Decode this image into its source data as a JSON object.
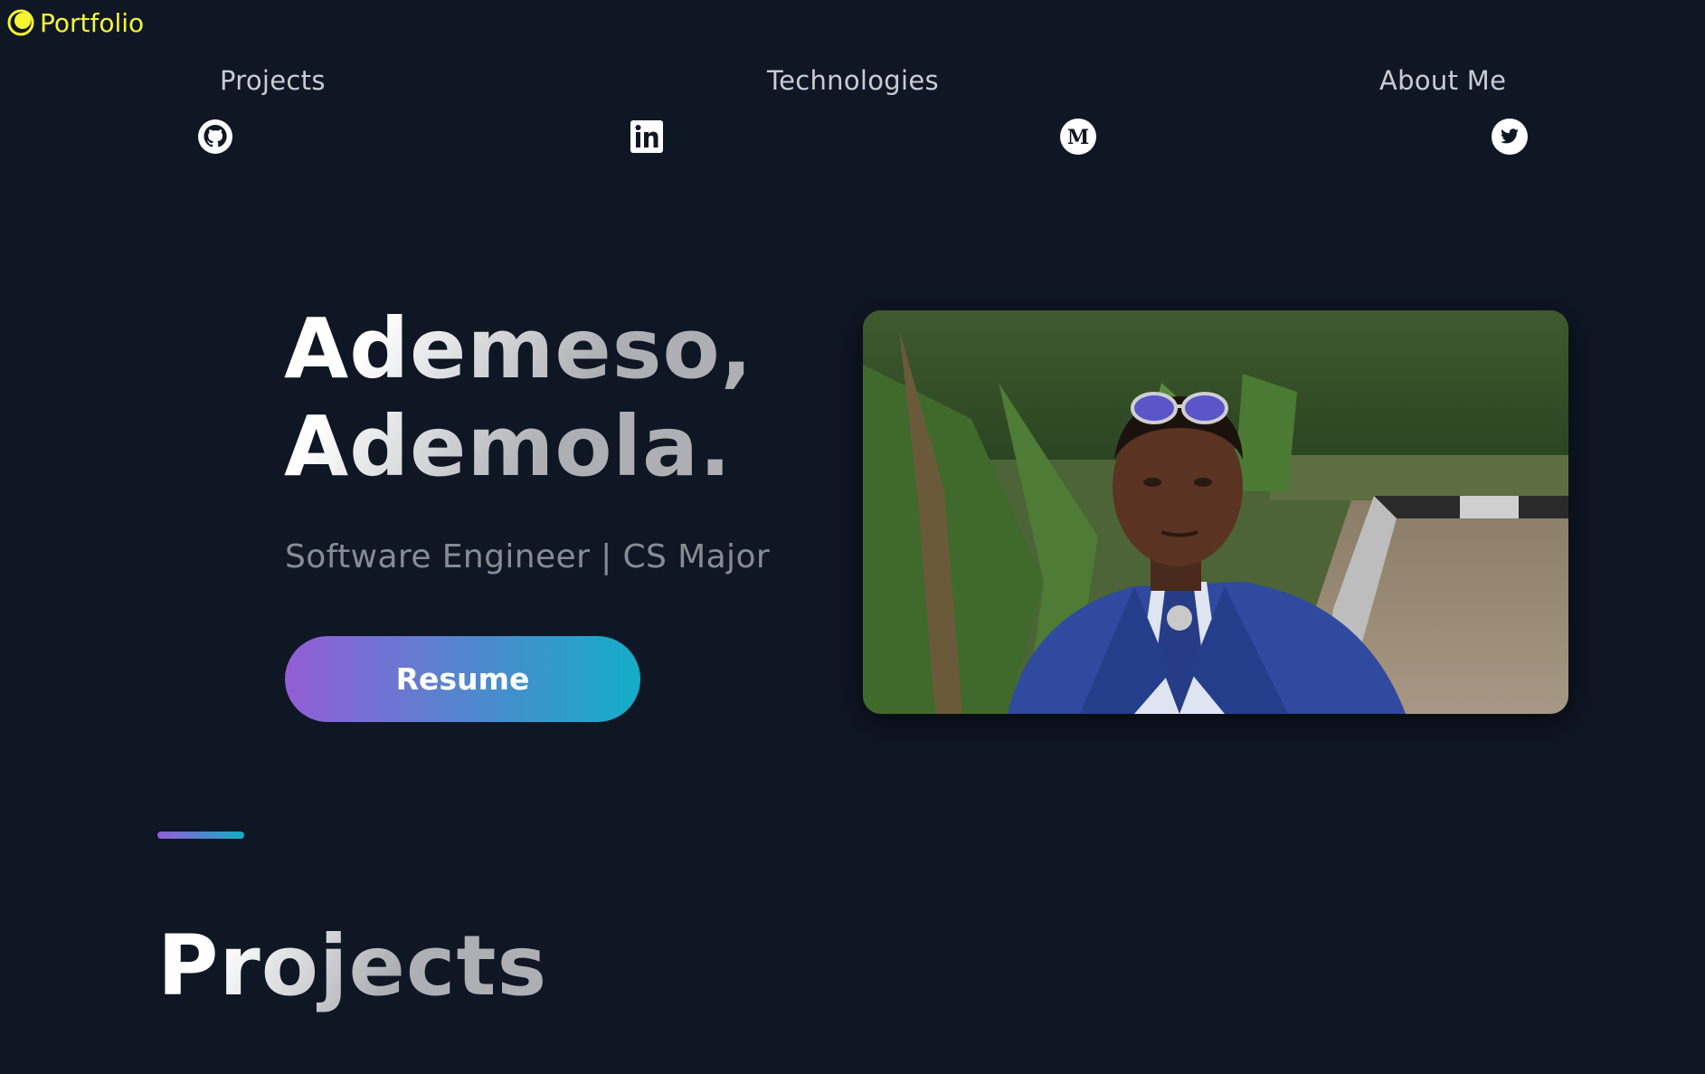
{
  "header": {
    "logo_label": "Portfolio",
    "logo_color": "#f5f533",
    "nav": [
      {
        "label": "Projects"
      },
      {
        "label": "Technologies"
      },
      {
        "label": "About Me"
      }
    ],
    "socials": [
      {
        "icon": "github-icon"
      },
      {
        "icon": "linkedin-icon"
      },
      {
        "icon": "medium-icon"
      },
      {
        "icon": "twitter-icon"
      }
    ]
  },
  "hero": {
    "title_line1": "Ademeso,",
    "title_line2": "Ademola.",
    "subtitle": "Software Engineer | CS Major",
    "resume_label": "Resume",
    "photo_alt": "Portrait photo of a young man in a blue suit with sunglasses on his head"
  },
  "section": {
    "title": "Projects"
  },
  "colors": {
    "background": "#0f1624",
    "gradient_start": "#945dd6",
    "gradient_end": "#13adc7"
  }
}
